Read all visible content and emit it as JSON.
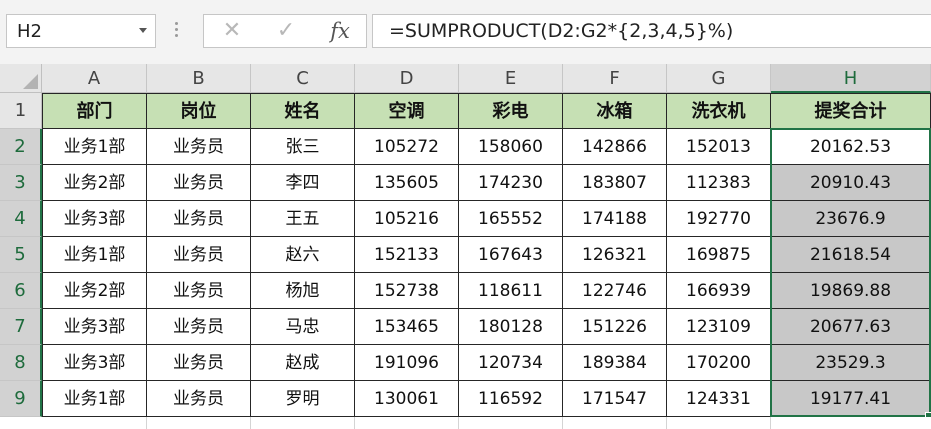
{
  "name_box": {
    "value": "H2"
  },
  "formula_buttons": {
    "cancel": "✕",
    "enter": "✓",
    "fx": "fx"
  },
  "formula": "=SUMPRODUCT(D2:G2*{2,3,4,5}%)",
  "columns": [
    "A",
    "B",
    "C",
    "D",
    "E",
    "F",
    "G",
    "H"
  ],
  "rows": [
    "1",
    "2",
    "3",
    "4",
    "5",
    "6",
    "7",
    "8",
    "9"
  ],
  "header_row": [
    "部门",
    "岗位",
    "姓名",
    "空调",
    "彩电",
    "冰箱",
    "洗衣机",
    "提奖合计"
  ],
  "data_rows": [
    [
      "业务1部",
      "业务员",
      "张三",
      "105272",
      "158060",
      "142866",
      "152013",
      "20162.53"
    ],
    [
      "业务2部",
      "业务员",
      "李四",
      "135605",
      "174230",
      "183807",
      "112383",
      "20910.43"
    ],
    [
      "业务3部",
      "业务员",
      "王五",
      "105216",
      "165552",
      "174188",
      "192770",
      "23676.9"
    ],
    [
      "业务1部",
      "业务员",
      "赵六",
      "152133",
      "167643",
      "126321",
      "169875",
      "21618.54"
    ],
    [
      "业务2部",
      "业务员",
      "杨旭",
      "152738",
      "118611",
      "122746",
      "166939",
      "19869.88"
    ],
    [
      "业务3部",
      "业务员",
      "马忠",
      "153465",
      "180128",
      "151226",
      "123109",
      "20677.63"
    ],
    [
      "业务3部",
      "业务员",
      "赵成",
      "191096",
      "120734",
      "189384",
      "170200",
      "23529.3"
    ],
    [
      "业务1部",
      "业务员",
      "罗明",
      "130061",
      "116592",
      "171547",
      "124331",
      "19177.41"
    ]
  ],
  "selected_column": "H",
  "selected_rows": [
    "2",
    "3",
    "4",
    "5",
    "6",
    "7",
    "8",
    "9"
  ],
  "colors": {
    "header_fill": "#c6e0b4",
    "selection": "#217346",
    "highlight": "#c8c8c8"
  }
}
